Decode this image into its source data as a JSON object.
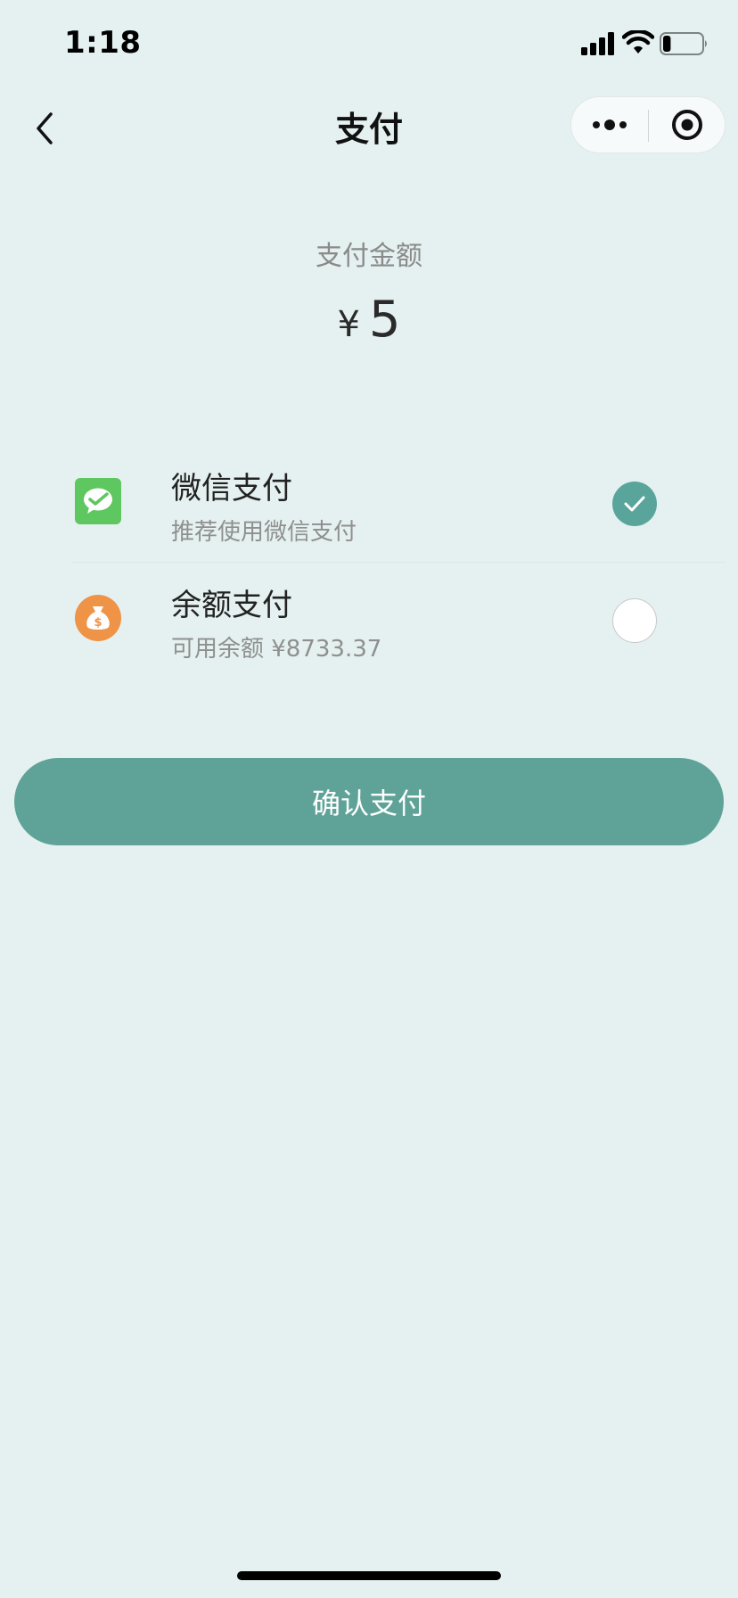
{
  "status_bar": {
    "time": "1:18",
    "battery_level": 0.2
  },
  "nav": {
    "title": "支付"
  },
  "amount": {
    "label": "支付金额",
    "currency": "¥",
    "value": "5"
  },
  "payment_methods": [
    {
      "title": "微信支付",
      "subtitle": "推荐使用微信支付",
      "icon": "wechat-pay-icon",
      "selected": true
    },
    {
      "title": "余额支付",
      "subtitle": "可用余额 ¥8733.37",
      "icon": "money-bag-icon",
      "selected": false
    }
  ],
  "confirm_button": {
    "label": "确认支付"
  },
  "colors": {
    "background": "#e4f1f0",
    "accent": "#5fa398",
    "wechat_green": "#5fc75f",
    "balance_orange": "#ef9347"
  }
}
